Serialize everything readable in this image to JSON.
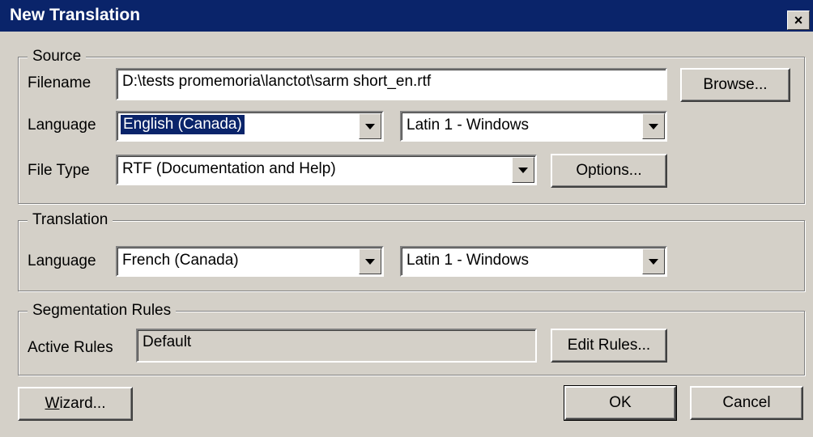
{
  "window": {
    "title": "New Translation",
    "close_glyph": "×"
  },
  "source": {
    "legend": "Source",
    "filename_label": "Filename",
    "filename_value": "D:\\tests promemoria\\lanctot\\sarm short_en.rtf",
    "browse_label": "Browse...",
    "language_label": "Language",
    "language_value": "English (Canada)",
    "encoding_value": "Latin 1 - Windows",
    "filetype_label": "File Type",
    "filetype_value": "RTF (Documentation and Help)",
    "options_label": "Options..."
  },
  "translation": {
    "legend": "Translation",
    "language_label": "Language",
    "language_value": "French (Canada)",
    "encoding_value": "Latin 1 - Windows"
  },
  "segmentation": {
    "legend": "Segmentation Rules",
    "active_label": "Active Rules",
    "active_value": "Default",
    "edit_label": "Edit Rules..."
  },
  "buttons": {
    "wizard_accel": "W",
    "wizard_rest": "izard...",
    "ok_label": "OK",
    "cancel_label": "Cancel"
  },
  "colors": {
    "titlebar": "#0a246a",
    "face": "#d4d0c8",
    "selection": "#0a246a"
  },
  "icons": {
    "close": "close-icon",
    "dropdown": "chevron-down-icon"
  }
}
